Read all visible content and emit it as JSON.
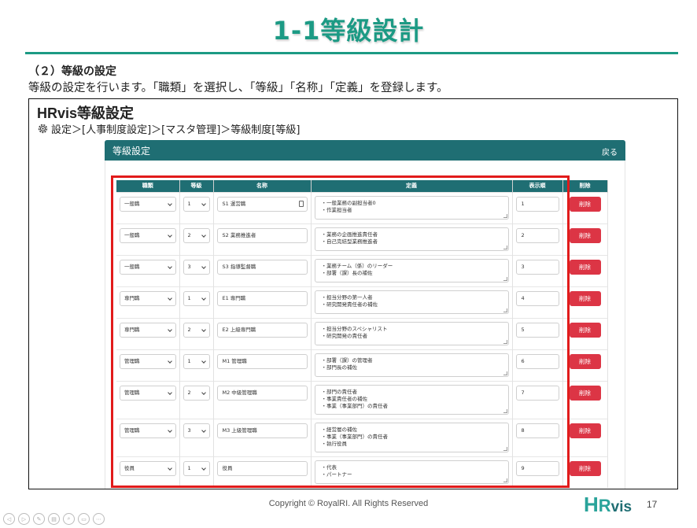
{
  "slide": {
    "title": "1-1等級設計",
    "section_heading": "（２）等級の設定",
    "description": "等級の設定を行います。「職類」を選択し、「等級」「名称」「定義」を登録します。",
    "footer": "Copyright © RoyalRI. All Rights Reserved",
    "page_number": "17",
    "logo": {
      "h": "H",
      "r": "R",
      "vis": "vis"
    },
    "accent_color": "#1c9a84"
  },
  "app": {
    "title": "HRvis等級設定",
    "breadcrumb": "設定＞[人事制度設定]＞[マスタ管理]＞等級制度[等級]",
    "panel_title": "等級設定",
    "back_label": "戻る",
    "header_color": "#1f6e73",
    "table": {
      "headers": [
        "職類",
        "等級",
        "名称",
        "定義",
        "表示順",
        "削除"
      ],
      "rows": [
        {
          "category": "一般職",
          "grade": "1",
          "name": "S1 運営職",
          "def_lines": [
            "・一般業務の副担当者0",
            "・作業担当者"
          ],
          "order": "1",
          "delete_label": "削除"
        },
        {
          "category": "一般職",
          "grade": "2",
          "name": "S2 業務推進者",
          "def_lines": [
            "・業務の企画推進責任者",
            "・自己完結型業務推進者"
          ],
          "order": "2",
          "delete_label": "削除"
        },
        {
          "category": "一般職",
          "grade": "3",
          "name": "S3 指導監督職",
          "def_lines": [
            "・業務チーム（係）のリーダー",
            "・部署（課）長の補佐"
          ],
          "order": "3",
          "delete_label": "削除"
        },
        {
          "category": "専門職",
          "grade": "1",
          "name": "E1 専門職",
          "def_lines": [
            "・担当分野の第一人者",
            "・研究開発責任者の補佐"
          ],
          "order": "4",
          "delete_label": "削除"
        },
        {
          "category": "専門職",
          "grade": "2",
          "name": "E2 上級専門職",
          "def_lines": [
            "・担当分野のスペシャリスト",
            "・研究開発の責任者"
          ],
          "order": "5",
          "delete_label": "削除"
        },
        {
          "category": "管理職",
          "grade": "1",
          "name": "M1 管理職",
          "def_lines": [
            "・部署（課）の管理者",
            "・部門長の補佐"
          ],
          "order": "6",
          "delete_label": "削除"
        },
        {
          "category": "管理職",
          "grade": "2",
          "name": "M2 中級管理職",
          "def_lines": [
            "・部門の責任者",
            "・事業責任者の補佐",
            "・事業（事業部門）の責任者"
          ],
          "order": "7",
          "delete_label": "削除"
        },
        {
          "category": "管理職",
          "grade": "3",
          "name": "M3 上級管理職",
          "def_lines": [
            "・経営層の補佐",
            "・事業（事業部門）の責任者",
            "・執行役員"
          ],
          "order": "8",
          "delete_label": "削除"
        },
        {
          "category": "役員",
          "grade": "1",
          "name": "役員",
          "def_lines": [
            "・代表",
            "・パートナー"
          ],
          "order": "9",
          "delete_label": "削除"
        }
      ]
    }
  }
}
